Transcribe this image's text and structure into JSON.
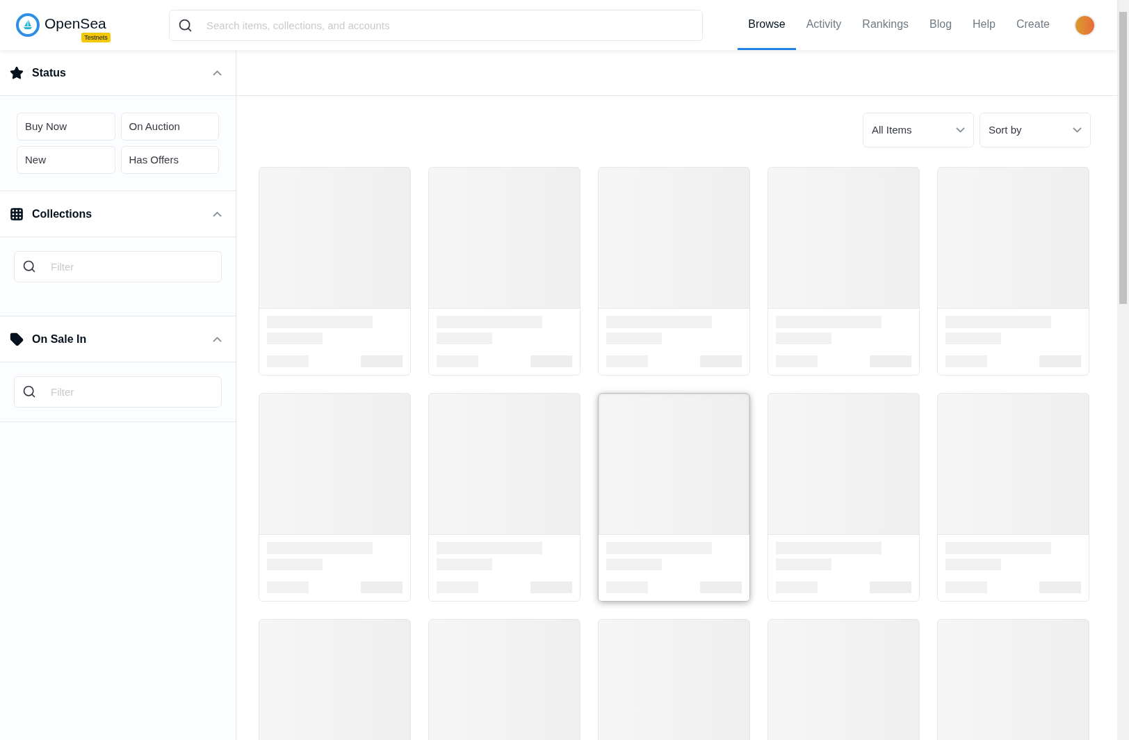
{
  "logo": {
    "name": "OpenSea",
    "badge": "Testnets"
  },
  "search": {
    "placeholder": "Search items, collections, and accounts"
  },
  "nav": [
    {
      "label": "Browse",
      "selected": true
    },
    {
      "label": "Activity",
      "selected": false
    },
    {
      "label": "Rankings",
      "selected": false
    },
    {
      "label": "Blog",
      "selected": false
    },
    {
      "label": "Help",
      "selected": false
    },
    {
      "label": "Create",
      "selected": false
    }
  ],
  "sidebar": [
    {
      "kind": "status",
      "title": "Status",
      "expanded": true,
      "options": [
        "Buy Now",
        "On Auction",
        "New",
        "Has Offers"
      ]
    },
    {
      "kind": "collections",
      "title": "Collections",
      "expanded": true,
      "filter_placeholder": "Filter"
    },
    {
      "kind": "sale",
      "title": "On Sale In",
      "expanded": true,
      "filter_placeholder": "Filter"
    }
  ],
  "dropdowns": [
    "All Items",
    "Sort by"
  ],
  "cards": [
    {
      "highlighted": false
    },
    {
      "highlighted": false
    },
    {
      "highlighted": false
    },
    {
      "highlighted": false
    },
    {
      "highlighted": false
    },
    {
      "highlighted": false
    },
    {
      "highlighted": false
    },
    {
      "highlighted": true
    },
    {
      "highlighted": false
    },
    {
      "highlighted": false
    },
    {
      "highlighted": false
    },
    {
      "highlighted": false
    },
    {
      "highlighted": false
    },
    {
      "highlighted": false
    },
    {
      "highlighted": false
    }
  ]
}
